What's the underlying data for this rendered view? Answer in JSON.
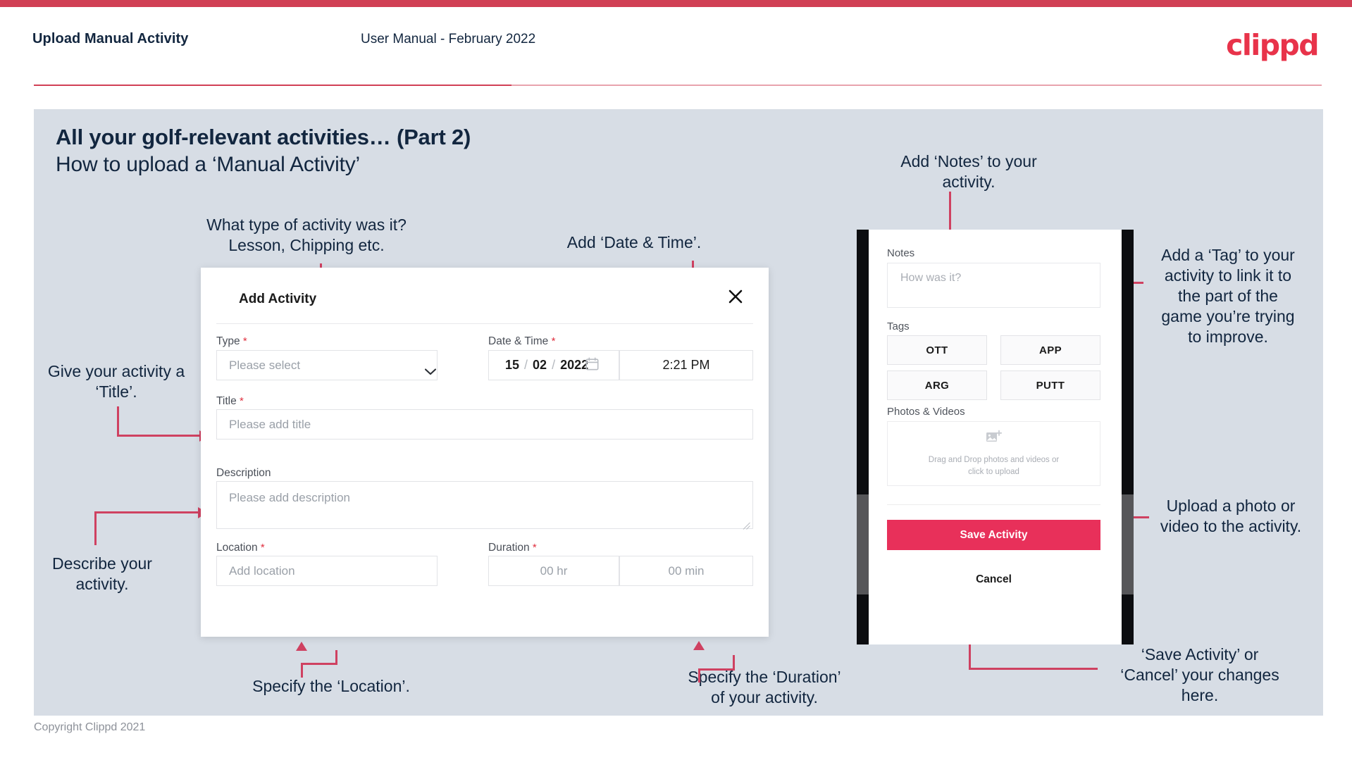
{
  "header": {
    "title": "Upload Manual Activity",
    "subtitle": "User Manual - February 2022",
    "logo": "clippd"
  },
  "slide": {
    "title": "All your golf-relevant activities… (Part 2)",
    "subtitle": "How to upload a ‘Manual Activity’"
  },
  "annotations": {
    "type": "What type of activity was it?\nLesson, Chipping etc.",
    "datetime": "Add ‘Date & Time’.",
    "notes": "Add ‘Notes’ to your\nactivity.",
    "tag": "Add a ‘Tag’ to your\nactivity to link it to\nthe part of the\ngame you’re trying\nto improve.",
    "title_field": "Give your activity a\n‘Title’.",
    "description": "Describe your\nactivity.",
    "location": "Specify the ‘Location’.",
    "duration": "Specify the ‘Duration’\nof your activity.",
    "upload": "Upload a photo or\nvideo to the activity.",
    "save_cancel": "‘Save Activity’ or\n‘Cancel’ your changes\nhere."
  },
  "dialog": {
    "title": "Add Activity",
    "close_icon": "close-icon",
    "fields": {
      "type": {
        "label": "Type",
        "required": "*",
        "placeholder": "Please select"
      },
      "datetime": {
        "label": "Date & Time",
        "required": "*",
        "day": "15",
        "month": "02",
        "year": "2022",
        "time": "2:21 PM",
        "sep": "/"
      },
      "title": {
        "label": "Title",
        "required": "*",
        "placeholder": "Please add title"
      },
      "description": {
        "label": "Description",
        "placeholder": "Please add description"
      },
      "location": {
        "label": "Location",
        "required": "*",
        "placeholder": "Add location"
      },
      "duration": {
        "label": "Duration",
        "required": "*",
        "hours": "00 hr",
        "minutes": "00 min"
      }
    }
  },
  "phone": {
    "notes": {
      "label": "Notes",
      "placeholder": "How was it?"
    },
    "tags": {
      "label": "Tags",
      "items": [
        "OTT",
        "APP",
        "ARG",
        "PUTT"
      ]
    },
    "photos": {
      "label": "Photos & Videos",
      "dropzone_line1": "Drag and Drop photos and videos or",
      "dropzone_line2": "click to upload",
      "icon": "add-image-icon"
    },
    "save_label": "Save Activity",
    "cancel_label": "Cancel"
  },
  "footer": {
    "copyright": "Copyright Clippd 2021"
  },
  "colors": {
    "brand_red": "#e8334a",
    "accent_pink": "#e8305a",
    "top_bar": "#d14055",
    "connector": "#cf4161",
    "slide_bg": "#d7dde5",
    "text_dark": "#12263f"
  }
}
